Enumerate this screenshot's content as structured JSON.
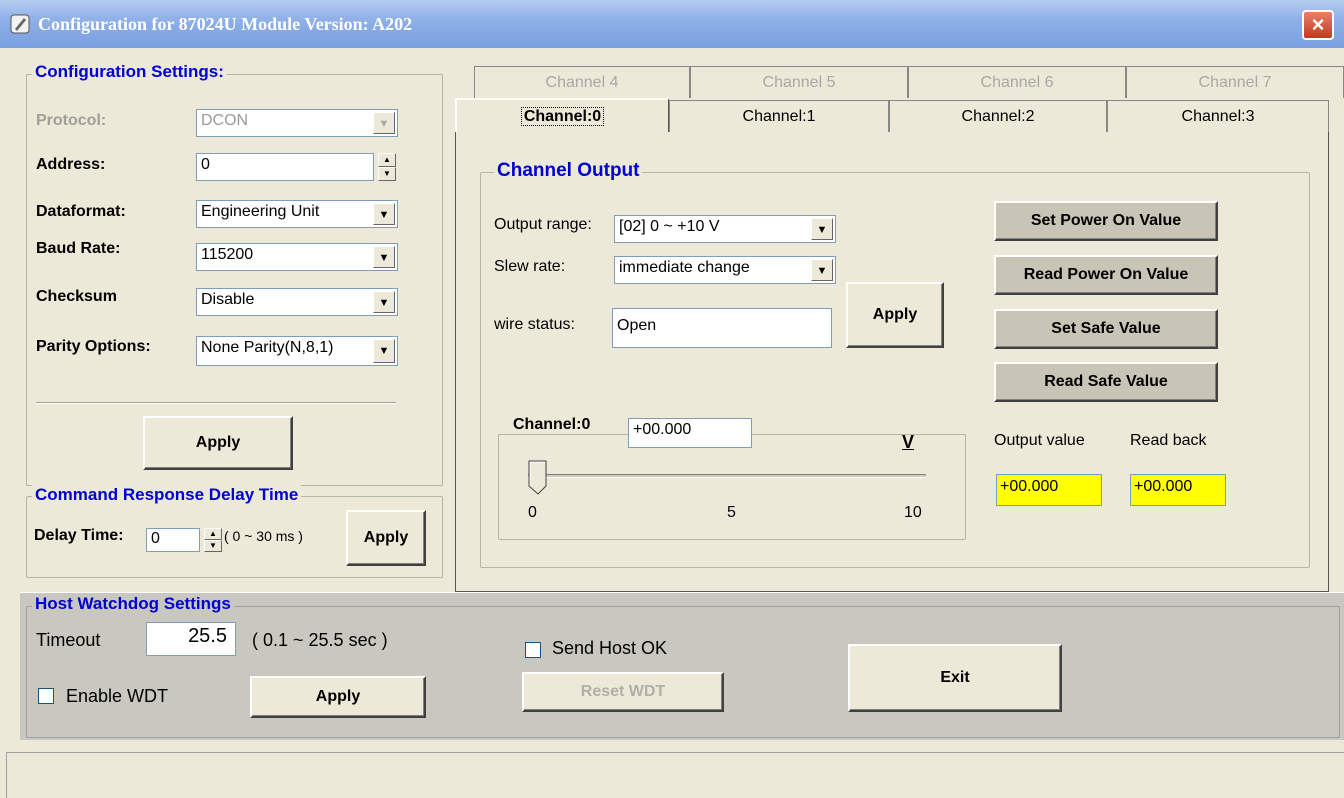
{
  "window": {
    "title": "Configuration for 87024U Module Version: A202",
    "close_label": "×"
  },
  "config": {
    "legend": "Configuration Settings:",
    "protocol_label": "Protocol:",
    "protocol_value": "DCON",
    "address_label": "Address:",
    "address_value": "0",
    "dataformat_label": "Dataformat:",
    "dataformat_value": "Engineering Unit",
    "baud_label": "Baud Rate:",
    "baud_value": "115200",
    "checksum_label": "Checksum",
    "checksum_value": "Disable",
    "parity_label": "Parity Options:",
    "parity_value": "None Parity(N,8,1)",
    "apply_label": "Apply"
  },
  "delay": {
    "legend": "Command Response Delay Time",
    "label": "Delay Time:",
    "value": "0",
    "range": "( 0 ~ 30 ms )",
    "apply_label": "Apply"
  },
  "tabs": {
    "back_row": [
      "Channel 4",
      "Channel 5",
      "Channel 6",
      "Channel 7"
    ],
    "front_row": [
      "Channel:0",
      "Channel:1",
      "Channel:2",
      "Channel:3"
    ],
    "selected": "Channel:0"
  },
  "channel_output": {
    "legend": "Channel Output",
    "range_label": "Output range:",
    "range_value": "[02] 0 ~ +10 V",
    "slew_label": "Slew rate:",
    "slew_value": "immediate change",
    "wire_label": "wire status:",
    "wire_value": "Open",
    "apply_label": "Apply",
    "set_power_on": "Set Power On Value",
    "read_power_on": "Read Power On Value",
    "set_safe": "Set Safe Value",
    "read_safe": "Read Safe Value",
    "slider": {
      "label": "Channel:0",
      "value_text": "+00.000",
      "unit": "V",
      "min_label": "0",
      "mid_label": "5",
      "max_label": "10",
      "level": 0
    },
    "output_value_label": "Output value",
    "output_value": "+00.000",
    "read_back_label": "Read back",
    "read_back_value": "+00.000"
  },
  "watchdog": {
    "legend": "Host Watchdog Settings",
    "timeout_label": "Timeout",
    "timeout_value": "25.5",
    "timeout_range": "( 0.1 ~ 25.5 sec )",
    "enable_label": "Enable WDT",
    "enable_checked": false,
    "apply_label": "Apply",
    "send_host_ok_label": "Send Host OK",
    "send_host_ok_checked": false,
    "reset_label": "Reset WDT",
    "exit_label": "Exit"
  }
}
